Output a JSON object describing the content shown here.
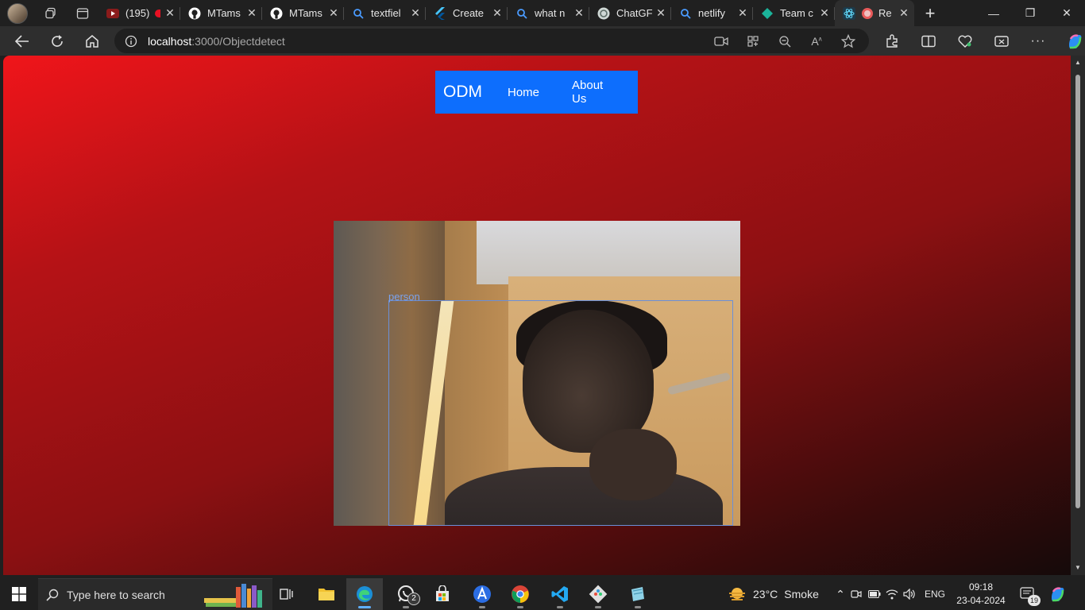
{
  "browser": {
    "tabs": [
      {
        "title": "(195)",
        "icon": "youtube-icon"
      },
      {
        "title": "MTams",
        "icon": "github-icon"
      },
      {
        "title": "MTams",
        "icon": "github-icon"
      },
      {
        "title": "textfiel",
        "icon": "search-icon"
      },
      {
        "title": "Create",
        "icon": "flutter-icon"
      },
      {
        "title": "what n",
        "icon": "search-icon"
      },
      {
        "title": "ChatGF",
        "icon": "chatgpt-icon"
      },
      {
        "title": "netlify",
        "icon": "search-icon"
      },
      {
        "title": "Team c",
        "icon": "teams-icon"
      },
      {
        "title": "Re",
        "icon": "react-icon",
        "active": true
      }
    ],
    "url_host": "localhost",
    "url_path": ":3000/Objectdetect"
  },
  "page": {
    "navbar": {
      "brand": "ODM",
      "links": [
        "Home",
        "About Us"
      ],
      "color": "#0d6efd"
    },
    "detection": {
      "label": "person",
      "box_color": "#6a8fd8"
    }
  },
  "taskbar": {
    "search_placeholder": "Type here to search",
    "whatsapp_badge": "2",
    "weather_temp": "23°C",
    "weather_desc": "Smoke",
    "language": "ENG",
    "time": "09:18",
    "date": "23-04-2024",
    "notification_count": "19"
  }
}
